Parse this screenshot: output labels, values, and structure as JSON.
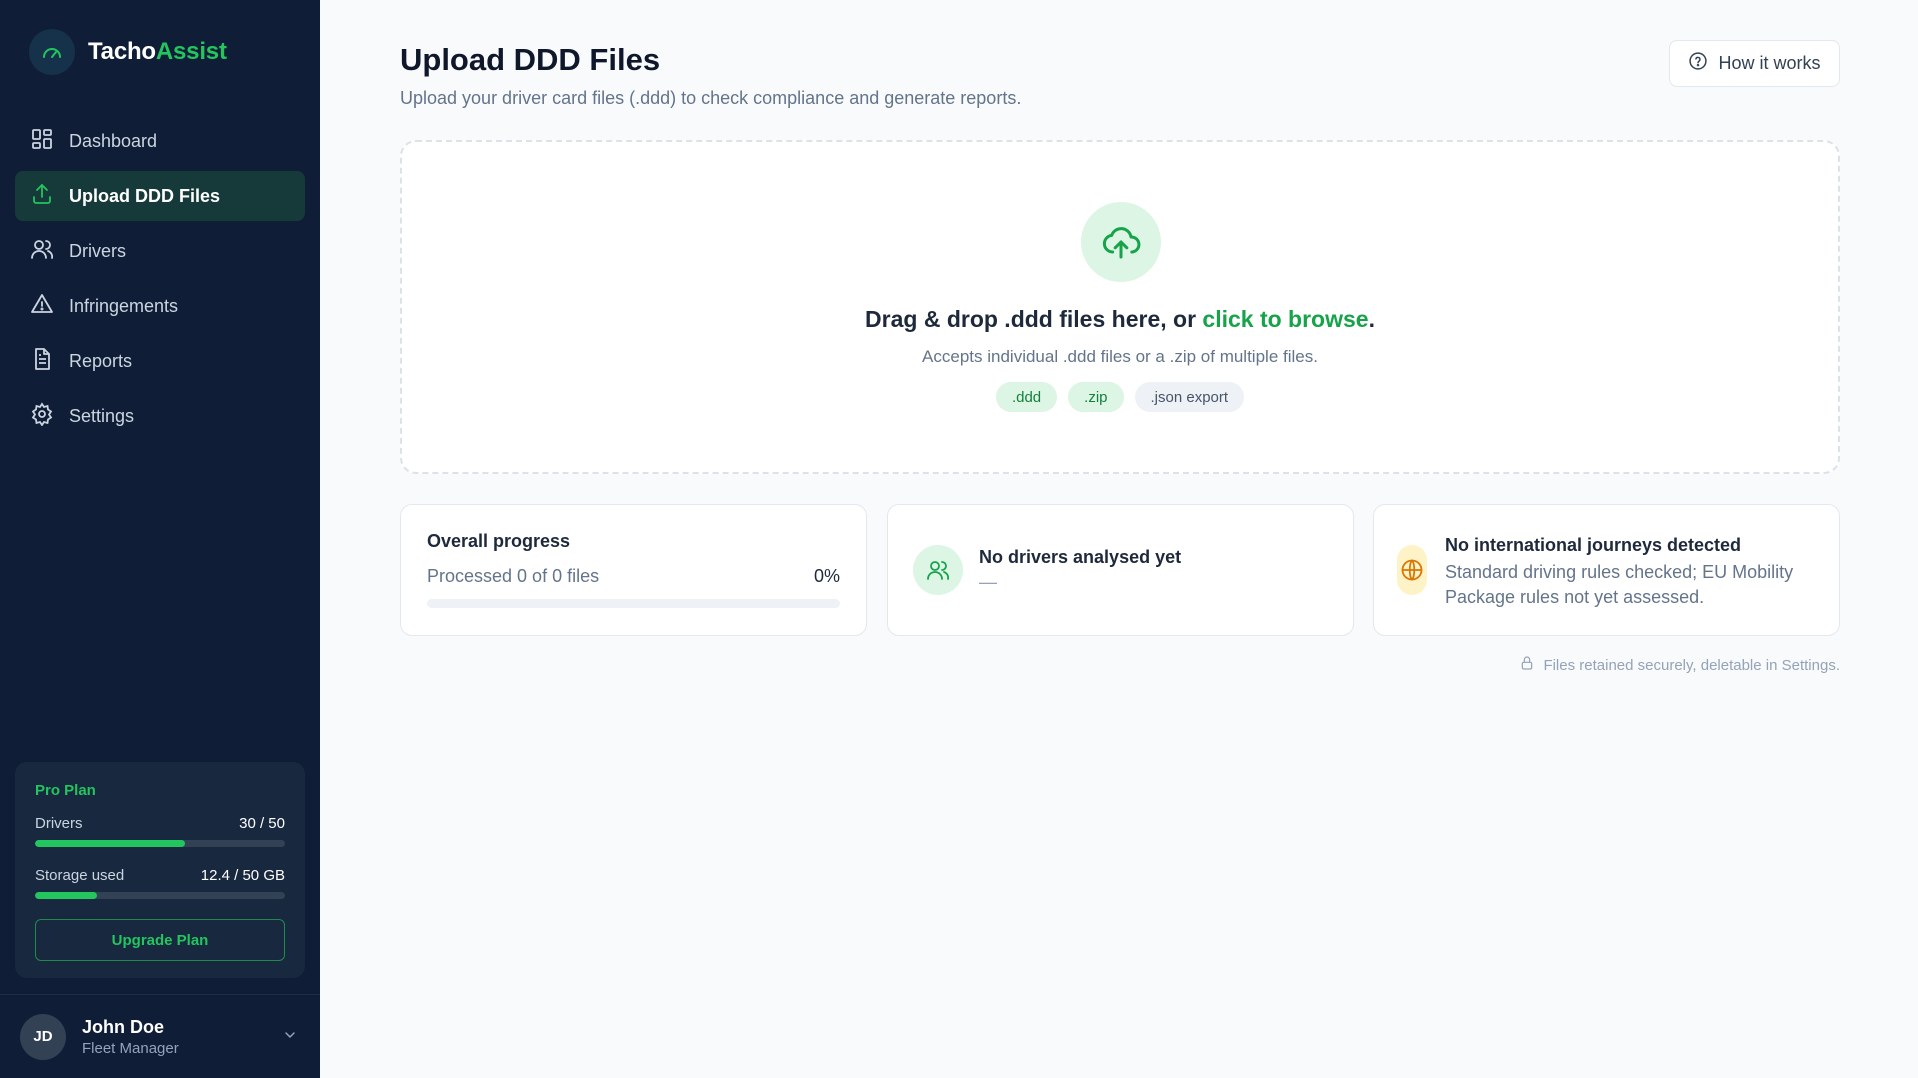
{
  "brand": {
    "name_part1": "Tacho",
    "name_part2": "Assist"
  },
  "sidebar": {
    "items": [
      {
        "label": "Dashboard",
        "icon": "dashboard-grid-icon",
        "active": false
      },
      {
        "label": "Upload DDD Files",
        "icon": "upload-icon",
        "active": true
      },
      {
        "label": "Drivers",
        "icon": "users-icon",
        "active": false
      },
      {
        "label": "Infringements",
        "icon": "warning-triangle-icon",
        "active": false
      },
      {
        "label": "Reports",
        "icon": "document-icon",
        "active": false
      },
      {
        "label": "Settings",
        "icon": "gear-icon",
        "active": false
      }
    ]
  },
  "plan": {
    "title": "Pro Plan",
    "drivers_label": "Drivers",
    "drivers_value": "30 / 50",
    "drivers_fraction": 0.6,
    "storage_label": "Storage used",
    "storage_value": "12.4 / 50 GB",
    "storage_fraction": 0.248,
    "upgrade_label": "Upgrade Plan"
  },
  "user": {
    "initials": "JD",
    "name": "John Doe",
    "role": "Fleet Manager"
  },
  "header": {
    "title": "Upload DDD Files",
    "subtitle": "Upload your driver card files (.ddd) to check compliance and generate reports.",
    "how_label": "How it works"
  },
  "dropzone": {
    "title_prefix": "Drag & drop .ddd files here, or ",
    "title_link": "click to browse",
    "title_suffix": ".",
    "subtitle": "Accepts individual .ddd files or a .zip of multiple files.",
    "chips": [
      ".ddd",
      ".zip",
      ".json export"
    ]
  },
  "progress_card": {
    "title": "Overall progress",
    "status": "Processed 0 of 0 files",
    "percent_label": "0%",
    "fraction": 0
  },
  "drivers_card": {
    "title": "No drivers analysed yet",
    "value": "—"
  },
  "journeys_card": {
    "title": "No international journeys detected",
    "text": "Standard driving rules checked; EU Mobility Package rules not yet assessed."
  },
  "security_note": "Files retained securely, deletable in Settings.",
  "colors": {
    "sidebar_bg": "#0f1e36",
    "accent": "#22c55e",
    "page_bg": "#f8fafc"
  }
}
